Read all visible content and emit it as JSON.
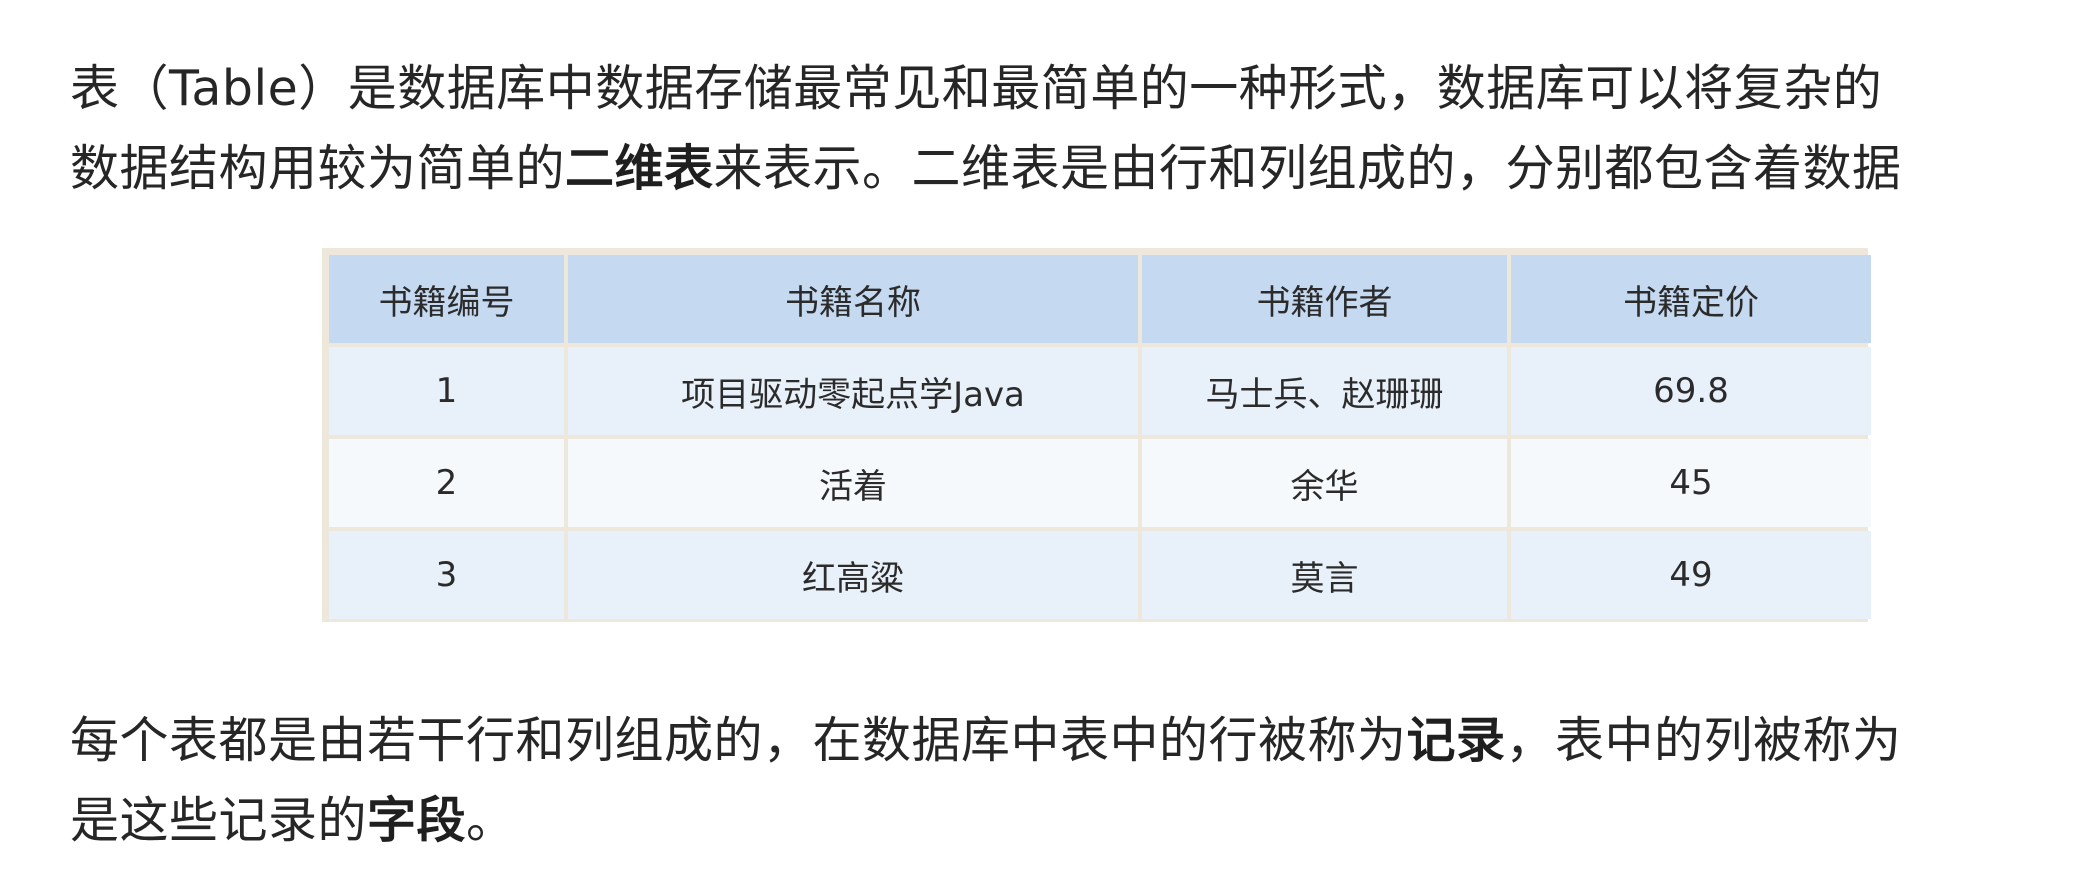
{
  "intro": {
    "line1": "表（Table）是数据库中数据存储最常见和最简单的一种形式，数据库可以将复杂的",
    "line2_pre": "数据结构用较为简单的",
    "line2_bold": "二维表",
    "line2_post": "来表示。二维表是由行和列组成的，分别都包含着数据"
  },
  "table": {
    "headers": [
      "书籍编号",
      "书籍名称",
      "书籍作者",
      "书籍定价"
    ],
    "rows": [
      [
        "1",
        "项目驱动零起点学Java",
        "马士兵、赵珊珊",
        "69.8"
      ],
      [
        "2",
        "活着",
        "余华",
        "45"
      ],
      [
        "3",
        "红高粱",
        "莫言",
        "49"
      ]
    ]
  },
  "outro": {
    "line1_pre": "每个表都是由若干行和列组成的，在数据库中表中的行被称为",
    "line1_bold": "记录",
    "line1_post": "，表中的列被称为",
    "line2_pre": "是这些记录的",
    "line2_bold": "字段",
    "line2_post": "。"
  }
}
